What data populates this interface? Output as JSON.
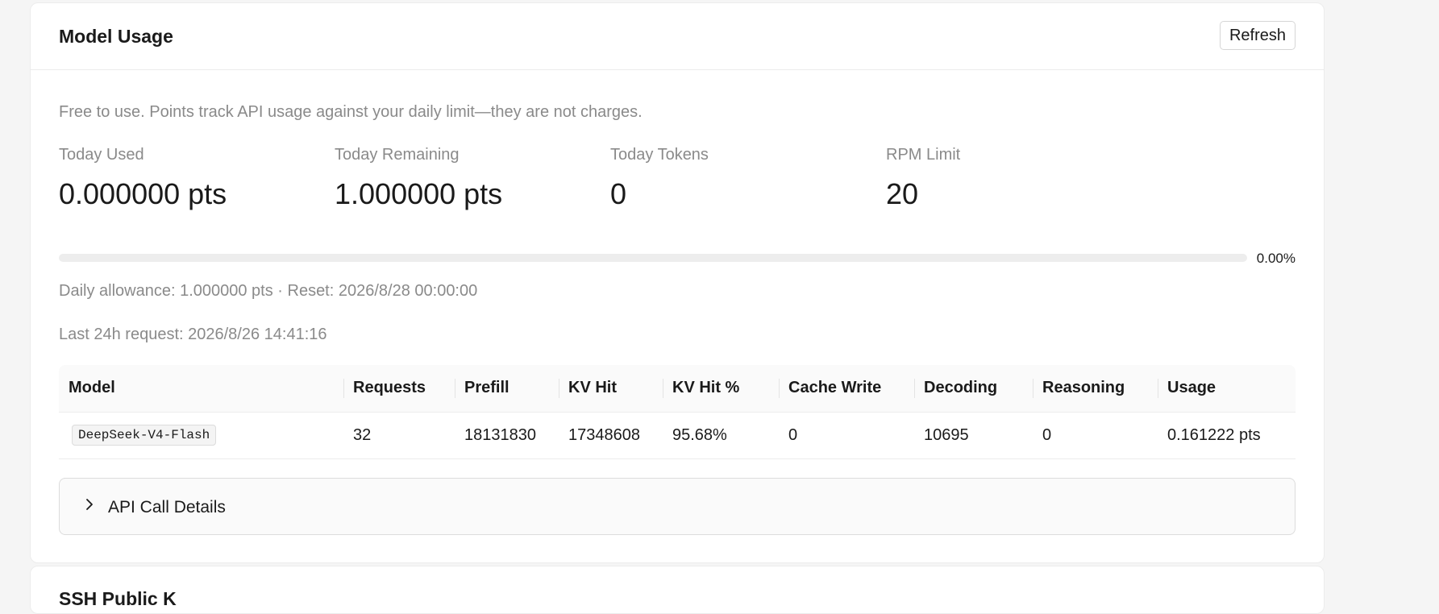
{
  "card": {
    "title": "Model Usage",
    "refresh_label": "Refresh",
    "notice": "Free to use. Points track API usage against your daily limit—they are not charges."
  },
  "stats": [
    {
      "label": "Today Used",
      "value": "0.000000 pts"
    },
    {
      "label": "Today Remaining",
      "value": "1.000000 pts"
    },
    {
      "label": "Today Tokens",
      "value": "0"
    },
    {
      "label": "RPM Limit",
      "value": "20"
    }
  ],
  "progress": {
    "percent_label": "0.00%",
    "fraction": 0.0,
    "color": "#4a7cf3"
  },
  "allowance_line": "Daily allowance: 1.000000 pts · Reset: 2026/8/28 00:00:00",
  "last_request_line": "Last 24h request: 2026/8/26 14:41:16",
  "table": {
    "headers": [
      "Model",
      "Requests",
      "Prefill",
      "KV Hit",
      "KV Hit %",
      "Cache Write",
      "Decoding",
      "Reasoning",
      "Usage"
    ],
    "rows": [
      [
        "DeepSeek-V4-Flash",
        "32",
        "18131830",
        "17348608",
        "95.68%",
        "0",
        "10695",
        "0",
        "0.161222 pts"
      ]
    ]
  },
  "details": {
    "label": "API Call Details",
    "icon": "chevron-right-icon"
  },
  "next_card": {
    "title": "SSH Public K"
  }
}
